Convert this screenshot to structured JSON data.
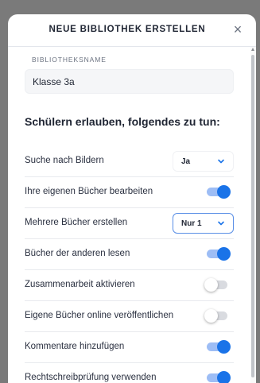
{
  "modal": {
    "title": "NEUE BIBLIOTHEK ERSTELLEN",
    "close_icon": "×"
  },
  "library_name": {
    "label": "BIBLIOTHEKSNAME",
    "value": "Klasse 3a"
  },
  "permissions": {
    "title": "Schülern erlauben, folgendes zu tun:",
    "rows": [
      {
        "label": "Suche nach Bildern",
        "control": "select",
        "value": "Ja"
      },
      {
        "label": "Ihre eigenen Bücher bearbeiten",
        "control": "toggle",
        "on": true
      },
      {
        "label": "Mehrere Bücher erstellen",
        "control": "select",
        "value": "Nur 1"
      },
      {
        "label": "Bücher der anderen lesen",
        "control": "toggle",
        "on": true
      },
      {
        "label": "Zusammenarbeit aktivieren",
        "control": "toggle",
        "on": false
      },
      {
        "label": "Eigene Bücher online veröffentlichen",
        "control": "toggle",
        "on": false
      },
      {
        "label": "Kommentare hinzufügen",
        "control": "toggle",
        "on": true
      },
      {
        "label": "Rechtschreibprüfung verwenden",
        "control": "toggle",
        "on": true
      }
    ]
  },
  "colors": {
    "accent": "#1a73e8",
    "toggle_on_track": "#9dbdf5",
    "toggle_off_track": "#d9dbe0",
    "overlay": "#7a7a7a"
  }
}
